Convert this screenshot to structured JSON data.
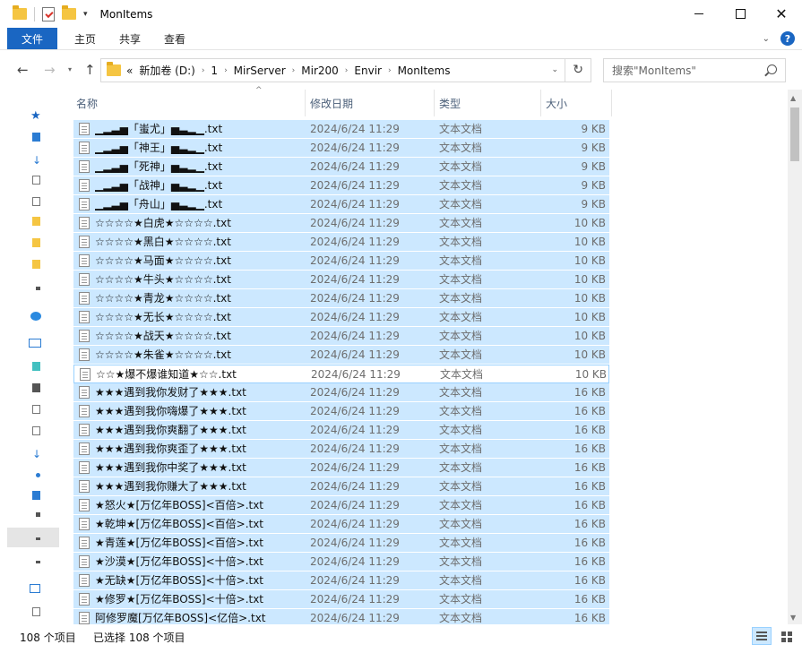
{
  "window": {
    "title": "MonItems"
  },
  "ribbon": {
    "tabs": [
      "文件",
      "主页",
      "共享",
      "查看"
    ]
  },
  "address": {
    "crumbs": [
      "新加卷 (D:)",
      "1",
      "MirServer",
      "Mir200",
      "Envir",
      "MonItems"
    ],
    "overflow": "«",
    "search_placeholder": "搜索\"MonItems\""
  },
  "columns": {
    "name": "名称",
    "date": "修改日期",
    "type": "类型",
    "size": "大小"
  },
  "files": [
    {
      "name": "▁▂▃▅「蚩尤」▅▃▂▁.txt",
      "date": "2024/6/24 11:29",
      "type": "文本文档",
      "size": "9 KB"
    },
    {
      "name": "▁▂▃▅「神王」▅▃▂▁.txt",
      "date": "2024/6/24 11:29",
      "type": "文本文档",
      "size": "9 KB"
    },
    {
      "name": "▁▂▃▅「死神」▅▃▂▁.txt",
      "date": "2024/6/24 11:29",
      "type": "文本文档",
      "size": "9 KB"
    },
    {
      "name": "▁▂▃▅「战神」▅▃▂▁.txt",
      "date": "2024/6/24 11:29",
      "type": "文本文档",
      "size": "9 KB"
    },
    {
      "name": "▁▂▃▅「舟山」▅▃▂▁.txt",
      "date": "2024/6/24 11:29",
      "type": "文本文档",
      "size": "9 KB"
    },
    {
      "name": "☆☆☆☆★白虎★☆☆☆☆.txt",
      "date": "2024/6/24 11:29",
      "type": "文本文档",
      "size": "10 KB"
    },
    {
      "name": "☆☆☆☆★黑白★☆☆☆☆.txt",
      "date": "2024/6/24 11:29",
      "type": "文本文档",
      "size": "10 KB"
    },
    {
      "name": "☆☆☆☆★马面★☆☆☆☆.txt",
      "date": "2024/6/24 11:29",
      "type": "文本文档",
      "size": "10 KB"
    },
    {
      "name": "☆☆☆☆★牛头★☆☆☆☆.txt",
      "date": "2024/6/24 11:29",
      "type": "文本文档",
      "size": "10 KB"
    },
    {
      "name": "☆☆☆☆★青龙★☆☆☆☆.txt",
      "date": "2024/6/24 11:29",
      "type": "文本文档",
      "size": "10 KB"
    },
    {
      "name": "☆☆☆☆★无长★☆☆☆☆.txt",
      "date": "2024/6/24 11:29",
      "type": "文本文档",
      "size": "10 KB"
    },
    {
      "name": "☆☆☆☆★战天★☆☆☆☆.txt",
      "date": "2024/6/24 11:29",
      "type": "文本文档",
      "size": "10 KB"
    },
    {
      "name": "☆☆☆☆★朱雀★☆☆☆☆.txt",
      "date": "2024/6/24 11:29",
      "type": "文本文档",
      "size": "10 KB"
    },
    {
      "name": "☆☆★爆不爆谁知道★☆☆.txt",
      "date": "2024/6/24 11:29",
      "type": "文本文档",
      "size": "10 KB"
    },
    {
      "name": "★★★遇到我你发财了★★★.txt",
      "date": "2024/6/24 11:29",
      "type": "文本文档",
      "size": "16 KB"
    },
    {
      "name": "★★★遇到我你嗨爆了★★★.txt",
      "date": "2024/6/24 11:29",
      "type": "文本文档",
      "size": "16 KB"
    },
    {
      "name": "★★★遇到我你爽翻了★★★.txt",
      "date": "2024/6/24 11:29",
      "type": "文本文档",
      "size": "16 KB"
    },
    {
      "name": "★★★遇到我你爽歪了★★★.txt",
      "date": "2024/6/24 11:29",
      "type": "文本文档",
      "size": "16 KB"
    },
    {
      "name": "★★★遇到我你中奖了★★★.txt",
      "date": "2024/6/24 11:29",
      "type": "文本文档",
      "size": "16 KB"
    },
    {
      "name": "★★★遇到我你赚大了★★★.txt",
      "date": "2024/6/24 11:29",
      "type": "文本文档",
      "size": "16 KB"
    },
    {
      "name": "★怒火★[万亿年BOSS]<百倍>.txt",
      "date": "2024/6/24 11:29",
      "type": "文本文档",
      "size": "16 KB"
    },
    {
      "name": "★乾坤★[万亿年BOSS]<百倍>.txt",
      "date": "2024/6/24 11:29",
      "type": "文本文档",
      "size": "16 KB"
    },
    {
      "name": "★青莲★[万亿年BOSS]<百倍>.txt",
      "date": "2024/6/24 11:29",
      "type": "文本文档",
      "size": "16 KB"
    },
    {
      "name": "★沙漠★[万亿年BOSS]<十倍>.txt",
      "date": "2024/6/24 11:29",
      "type": "文本文档",
      "size": "16 KB"
    },
    {
      "name": "★无缺★[万亿年BOSS]<十倍>.txt",
      "date": "2024/6/24 11:29",
      "type": "文本文档",
      "size": "16 KB"
    },
    {
      "name": "★修罗★[万亿年BOSS]<十倍>.txt",
      "date": "2024/6/24 11:29",
      "type": "文本文档",
      "size": "16 KB"
    },
    {
      "name": "阿修罗魔[万亿年BOSS]<亿倍>.txt",
      "date": "2024/6/24 11:29",
      "type": "文本文档",
      "size": "16 KB"
    }
  ],
  "focused_index": 13,
  "status": {
    "count": "108 个项目",
    "selected": "已选择 108 个项目"
  },
  "colors": {
    "accent": "#1a66c2",
    "selection": "#cce8ff",
    "selection_border": "#99d1ff"
  }
}
